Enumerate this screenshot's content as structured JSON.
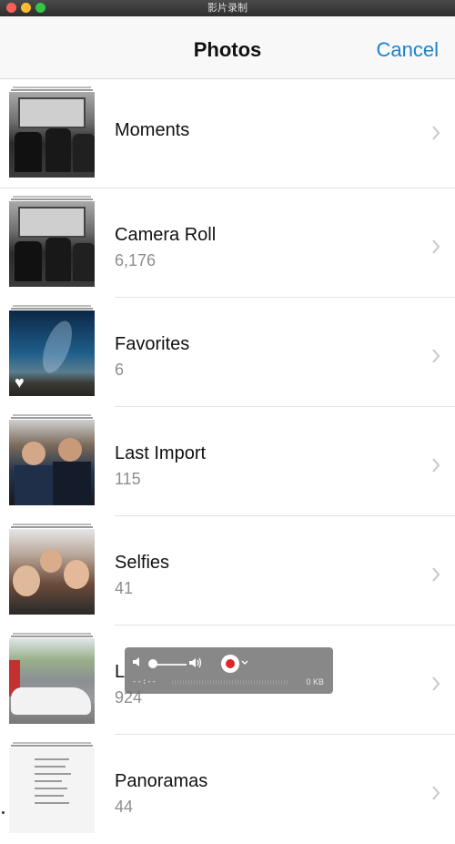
{
  "window": {
    "title": "影片录制"
  },
  "nav": {
    "title": "Photos",
    "cancel_label": "Cancel"
  },
  "albums": [
    {
      "label": "Moments",
      "count": ""
    },
    {
      "label": "Camera Roll",
      "count": "6,176"
    },
    {
      "label": "Favorites",
      "count": "6"
    },
    {
      "label": "Last Import",
      "count": "115"
    },
    {
      "label": "Selfies",
      "count": "41"
    },
    {
      "label": "L",
      "count": "924"
    },
    {
      "label": "Panoramas",
      "count": "44"
    }
  ],
  "recorder": {
    "time": "--:--",
    "size": "0 KB"
  },
  "colors": {
    "accent": "#1a82d0",
    "record": "#e0262b"
  }
}
